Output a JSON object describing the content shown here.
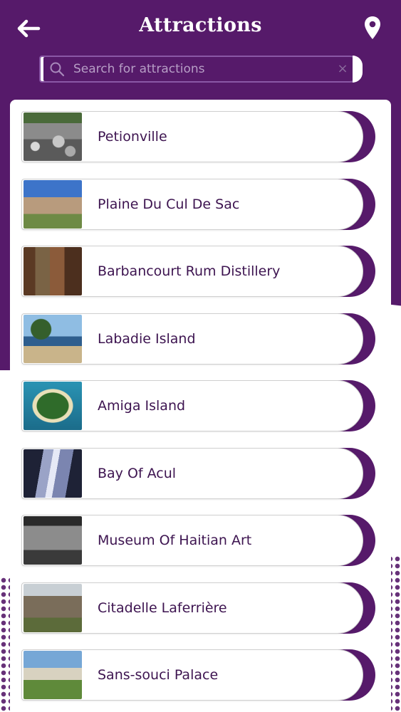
{
  "header": {
    "title": "Attractions",
    "back_icon": "arrow-left-icon",
    "location_icon": "map-pin-icon"
  },
  "search": {
    "placeholder": "Search for attractions",
    "value": "",
    "clear_glyph": "×"
  },
  "colors": {
    "primary": "#561a6a",
    "label_text": "#3d1450",
    "card_border": "#cfcfcf"
  },
  "attractions": [
    {
      "label": "Petionville",
      "thumb": "petionville-photo"
    },
    {
      "label": "Plaine Du Cul De Sac",
      "thumb": "plaine-du-cul-de-sac-photo"
    },
    {
      "label": "Barbancourt Rum Distillery",
      "thumb": "barbancourt-rum-distillery-photo"
    },
    {
      "label": "Labadie Island",
      "thumb": "labadie-island-photo"
    },
    {
      "label": "Amiga Island",
      "thumb": "amiga-island-photo"
    },
    {
      "label": "Bay Of Acul",
      "thumb": "bay-of-acul-photo"
    },
    {
      "label": "Museum Of Haitian Art",
      "thumb": "museum-of-haitian-art-photo"
    },
    {
      "label": "Citadelle Laferrière",
      "thumb": "citadelle-laferriere-photo"
    },
    {
      "label": "Sans-souci Palace",
      "thumb": "sans-souci-palace-photo"
    }
  ]
}
